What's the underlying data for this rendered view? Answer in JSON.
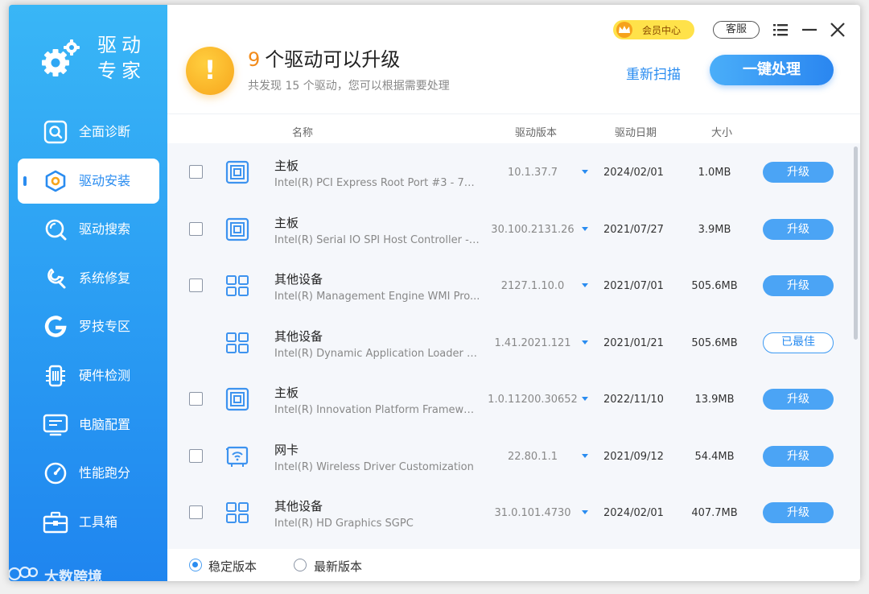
{
  "sidebar": {
    "brand_line1": "驱动",
    "brand_line2": "专家",
    "items": [
      {
        "label": "全面诊断",
        "icon": "magnifier-icon"
      },
      {
        "label": "驱动安装",
        "icon": "hexagon-icon",
        "active": true
      },
      {
        "label": "驱动搜索",
        "icon": "search-icon"
      },
      {
        "label": "系统修复",
        "icon": "wrench-icon"
      },
      {
        "label": "罗技专区",
        "icon": "logitech-icon"
      },
      {
        "label": "硬件检测",
        "icon": "chip-icon"
      },
      {
        "label": "电脑配置",
        "icon": "monitor-icon"
      },
      {
        "label": "性能跑分",
        "icon": "gauge-icon"
      },
      {
        "label": "工具箱",
        "icon": "toolbox-icon"
      }
    ],
    "watermark": "大数跨境"
  },
  "header": {
    "count": "9",
    "title": "个驱动可以升级",
    "subtitle": "共发现 15 个驱动，您可以根据需要处理",
    "rescan": "重新扫描",
    "one_key": "一键处理",
    "vip": "会员中心",
    "service": "客服"
  },
  "columns": {
    "name": "名称",
    "version": "驱动版本",
    "date": "驱动日期",
    "size": "大小"
  },
  "drivers": [
    {
      "category": "主板",
      "desc": "Intel(R) PCI Express Root Port #3 - 7A...",
      "version": "10.1.37.7",
      "date": "2024/02/01",
      "size": "1.0MB",
      "action": "升级",
      "checkbox": true,
      "icon": "motherboard-icon"
    },
    {
      "category": "主板",
      "desc": "Intel(R) Serial IO SPI Host Controller - ...",
      "version": "30.100.2131.26",
      "date": "2021/07/27",
      "size": "3.9MB",
      "action": "升级",
      "checkbox": true,
      "icon": "motherboard-icon"
    },
    {
      "category": "其他设备",
      "desc": "Intel(R) Management Engine WMI Pro...",
      "version": "2127.1.10.0",
      "date": "2021/07/01",
      "size": "505.6MB",
      "action": "升级",
      "checkbox": true,
      "icon": "grid-icon"
    },
    {
      "category": "其他设备",
      "desc": "Intel(R) Dynamic Application Loader H...",
      "version": "1.41.2021.121",
      "date": "2021/01/21",
      "size": "505.6MB",
      "action": "已最佳",
      "checkbox": false,
      "icon": "grid-icon"
    },
    {
      "category": "主板",
      "desc": "Intel(R) Innovation Platform Framewor...",
      "version": "1.0.11200.30652",
      "date": "2022/11/10",
      "size": "13.9MB",
      "action": "升级",
      "checkbox": true,
      "icon": "motherboard-icon"
    },
    {
      "category": "网卡",
      "desc": "Intel(R) Wireless Driver Customization",
      "version": "22.80.1.1",
      "date": "2021/09/12",
      "size": "54.4MB",
      "action": "升级",
      "checkbox": true,
      "icon": "wifi-card-icon"
    },
    {
      "category": "其他设备",
      "desc": "Intel(R) HD Graphics SGPC",
      "version": "31.0.101.4730",
      "date": "2024/02/01",
      "size": "407.7MB",
      "action": "升级",
      "checkbox": true,
      "icon": "grid-icon"
    }
  ],
  "footer": {
    "stable": "稳定版本",
    "latest": "最新版本",
    "selected": "stable"
  },
  "colors": {
    "accent": "#2a8cf0",
    "warn": "#f7a51c",
    "count": "#f28b1b"
  }
}
